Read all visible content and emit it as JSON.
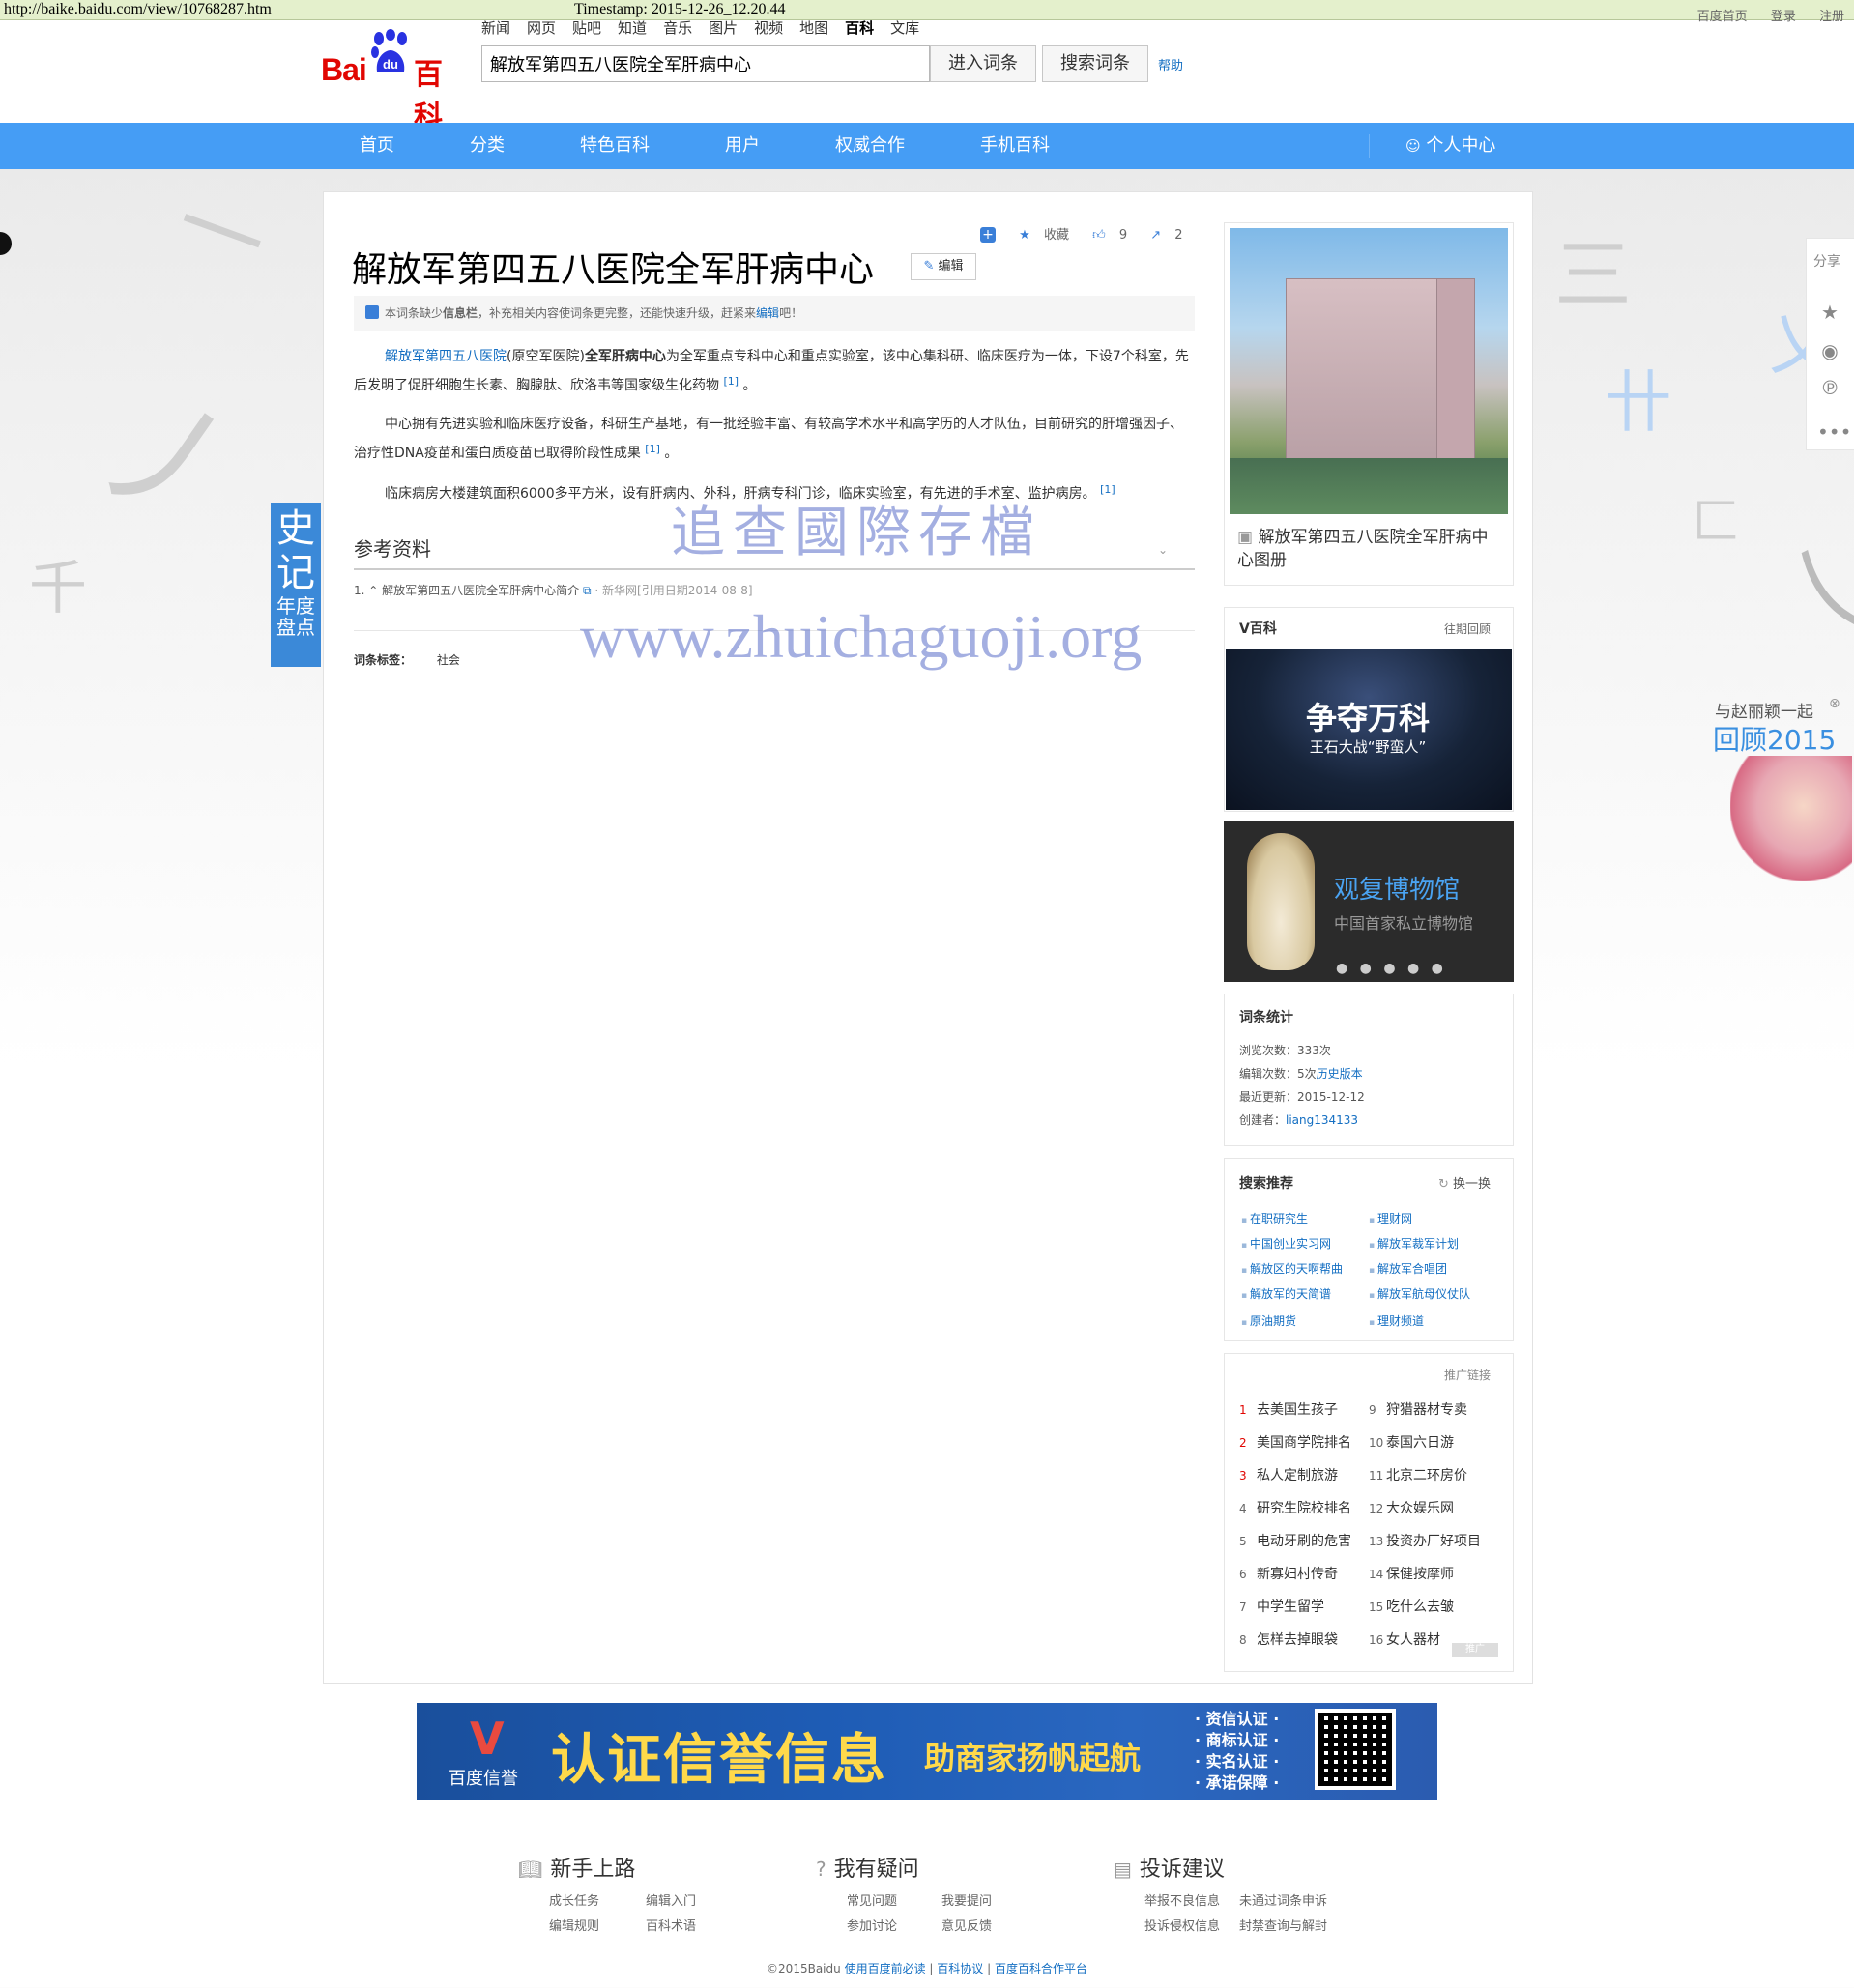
{
  "archive": {
    "url": "http://baike.baidu.com/view/10768287.htm",
    "timestamp": "Timestamp: 2015-12-26_12.20.44"
  },
  "header": {
    "top_links": [
      "百度首页",
      "登录",
      "注册"
    ],
    "logo_text_bai": "Bai",
    "logo_text_du": "du",
    "logo_text_baike": "百科",
    "nav_links": [
      "新闻",
      "网页",
      "贴吧",
      "知道",
      "音乐",
      "图片",
      "视频",
      "地图",
      "百科",
      "文库"
    ],
    "current_nav": "百科",
    "search_value": "解放军第四五八医院全军肝病中心",
    "btn_enter": "进入词条",
    "btn_search": "搜索词条",
    "help": "帮助"
  },
  "mainnav": {
    "items": [
      "首页",
      "分类",
      "特色百科",
      "用户",
      "权威合作",
      "手机百科"
    ],
    "user_center": "个人中心"
  },
  "ribbon": {
    "big": "史记",
    "small1": "年度",
    "small2": "盘点"
  },
  "article": {
    "title": "解放军第四五八医院全军肝病中心",
    "tools": {
      "collect": "收藏",
      "likes": "9",
      "shares": "2"
    },
    "edit": "编辑",
    "notice_pre": "本词条缺少",
    "notice_bold": "信息栏",
    "notice_mid": "，补充相关内容使词条更完整，还能快速升级，赶紧来",
    "notice_link": "编辑",
    "notice_post": "吧！",
    "p1_link": "解放军第四五八医院",
    "p1_a": "(原空军医院)",
    "p1_bold": "全军肝病中心",
    "p1_b": "为全军重点专科中心和重点实验室，该中心集科研、临床医疗为一体，下设7个科室，先后发明了促肝细胞生长素、胸腺肽、欣洛韦等国家级生化药物",
    "p1_sup": "[1]",
    "p1_end": "。",
    "p2": "中心拥有先进实验和临床医疗设备，科研生产基地，有一批经验丰富、有较高学术水平和高学历的人才队伍，目前研究的肝增强因子、治疗性DNA疫苗和蛋白质疫苗已取得阶段性成果",
    "p2_sup": "[1]",
    "p2_end": "。",
    "p3": "临床病房大楼建筑面积6000多平方米，设有肝病内、外科，肝病专科门诊，临床实验室，有先进的手术室、监护病房。",
    "p3_sup": "[1]",
    "ref_title": "参考资料",
    "ref_toggle": "⌄",
    "ref_num": "1.",
    "ref_text": "解放军第四五八医院全军肝病中心简介",
    "ref_src": "· 新华网[引用日期2014-08-8]",
    "tags_label": "词条标签：",
    "tags": [
      "社会"
    ]
  },
  "watermark": {
    "line1": "追查國際存檔",
    "line2": "www.zhuichaguoji.org"
  },
  "sidebar": {
    "album_caption": "解放军第四五八医院全军肝病中心图册",
    "vbaike_title": "V百科",
    "vbaike_more": "往期回顾",
    "vbaike_img_line1": "争夺万科",
    "vbaike_img_line2": "王石大战“野蛮人”",
    "museum_title": "观复博物馆",
    "museum_sub": "中国首家私立博物馆",
    "museum_dots": "● ● ● ● ●",
    "stats_title": "词条统计",
    "stats": {
      "views_label": "浏览次数：",
      "views": "333次",
      "edits_label": "编辑次数：",
      "edits": "5次",
      "history": "历史版本",
      "updated_label": "最近更新：",
      "updated": "2015-12-12",
      "creator_label": "创建者：",
      "creator": "liang134133"
    },
    "rec_title": "搜索推荐",
    "rec_refresh": "换一换",
    "rec_left": [
      "在职研究生",
      "中国创业实习网",
      "解放区的天啊帮曲",
      "解放军的天简谱",
      "原油期货"
    ],
    "rec_right": [
      "理财网",
      "解放军裁军计划",
      "解放军合唱团",
      "解放军航母仪仗队",
      "理财频道"
    ],
    "promo_label": "推广链接",
    "promo_left": [
      {
        "n": "1",
        "t": "去美国生孩子"
      },
      {
        "n": "2",
        "t": "美国商学院排名"
      },
      {
        "n": "3",
        "t": "私人定制旅游"
      },
      {
        "n": "4",
        "t": "研究生院校排名"
      },
      {
        "n": "5",
        "t": "电动牙刷的危害"
      },
      {
        "n": "6",
        "t": "新寡妇村传奇"
      },
      {
        "n": "7",
        "t": "中学生留学"
      },
      {
        "n": "8",
        "t": "怎样去掉眼袋"
      }
    ],
    "promo_right": [
      {
        "n": "9",
        "t": "狩猎器材专卖"
      },
      {
        "n": "10",
        "t": "泰国六日游"
      },
      {
        "n": "11",
        "t": "北京二环房价"
      },
      {
        "n": "12",
        "t": "大众娱乐网"
      },
      {
        "n": "13",
        "t": "投资办厂好项目"
      },
      {
        "n": "14",
        "t": "保健按摩师"
      },
      {
        "n": "15",
        "t": "吃什么去皱"
      },
      {
        "n": "16",
        "t": "女人器材"
      }
    ],
    "promo_mark": "推广"
  },
  "share": {
    "label": "分享"
  },
  "zl_ad": {
    "line1": "与赵丽颖一起",
    "line2": "回顾2015",
    "close": "⊗"
  },
  "banner": {
    "logo_v": "V",
    "logo_text": "百度信誉",
    "main": "认证信誉信息",
    "sub": "助商家扬帆起航",
    "list": [
      "· 资信认证 ·",
      "· 商标认证 ·",
      "· 实名认证 ·",
      "· 承诺保障 ·"
    ]
  },
  "footer": {
    "col1_title": "新手上路",
    "col1_links": [
      "成长任务",
      "编辑入门",
      "编辑规则",
      "百科术语"
    ],
    "col2_title": "我有疑问",
    "col2_links": [
      "常见问题",
      "我要提问",
      "参加讨论",
      "意见反馈"
    ],
    "col3_title": "投诉建议",
    "col3_links": [
      "举报不良信息",
      "未通过词条申诉",
      "投诉侵权信息",
      "封禁查询与解封"
    ],
    "copyright": "©2015Baidu",
    "c_link1": "使用百度前必读",
    "c_link2": "百科协议",
    "c_link3": "百度百科合作平台"
  },
  "colors": {
    "nav_blue": "#459df5",
    "link_blue": "#136ec2",
    "brand_red": "#e10602"
  }
}
